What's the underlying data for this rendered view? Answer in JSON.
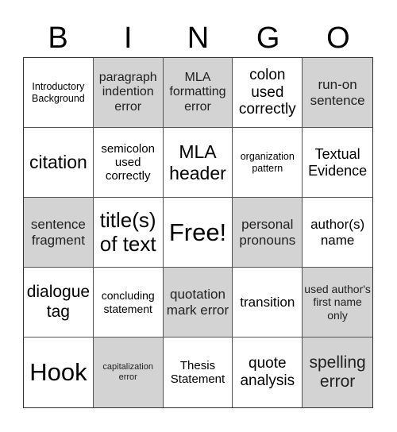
{
  "header": [
    "B",
    "I",
    "N",
    "G",
    "O"
  ],
  "cells": [
    {
      "text": "Introductory Background",
      "marked": false,
      "size": 13
    },
    {
      "text": "paragraph indention error",
      "marked": true,
      "size": 16
    },
    {
      "text": "MLA formatting error",
      "marked": true,
      "size": 16
    },
    {
      "text": "colon used correctly",
      "marked": false,
      "size": 19
    },
    {
      "text": "run-on sentence",
      "marked": true,
      "size": 17
    },
    {
      "text": "citation",
      "marked": false,
      "size": 22
    },
    {
      "text": "semicolon used correctly",
      "marked": false,
      "size": 15
    },
    {
      "text": "MLA header",
      "marked": false,
      "size": 22
    },
    {
      "text": "organization pattern",
      "marked": false,
      "size": 13
    },
    {
      "text": "Textual Evidence",
      "marked": false,
      "size": 18
    },
    {
      "text": "sentence fragment",
      "marked": true,
      "size": 17
    },
    {
      "text": "title(s) of text",
      "marked": false,
      "size": 24
    },
    {
      "text": "Free!",
      "marked": false,
      "size": 30
    },
    {
      "text": "personal pronouns",
      "marked": true,
      "size": 17
    },
    {
      "text": "author(s) name",
      "marked": false,
      "size": 17
    },
    {
      "text": "dialogue tag",
      "marked": false,
      "size": 20
    },
    {
      "text": "concluding statement",
      "marked": false,
      "size": 14
    },
    {
      "text": "quotation mark error",
      "marked": true,
      "size": 17
    },
    {
      "text": "transition",
      "marked": false,
      "size": 17
    },
    {
      "text": "used author's first name only",
      "marked": true,
      "size": 14
    },
    {
      "text": "Hook",
      "marked": false,
      "size": 30
    },
    {
      "text": "capitalization error",
      "marked": true,
      "size": 11
    },
    {
      "text": "Thesis Statement",
      "marked": false,
      "size": 15
    },
    {
      "text": "quote analysis",
      "marked": false,
      "size": 19
    },
    {
      "text": "spelling error",
      "marked": true,
      "size": 20
    }
  ]
}
